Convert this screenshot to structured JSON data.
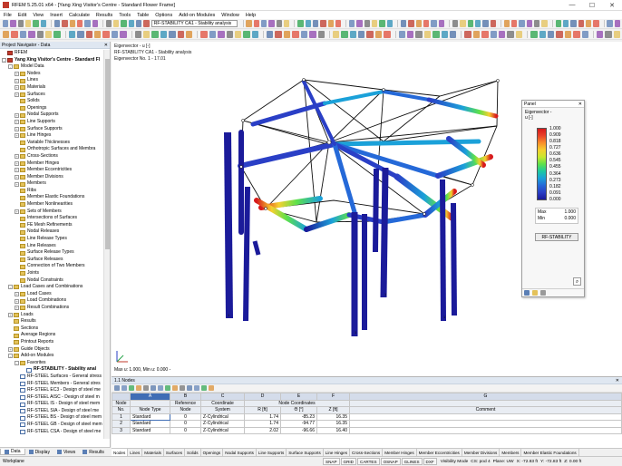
{
  "window": {
    "title": "RFEM 5.25.01 x64 - [Yang Xing Visitor's Centre - Standard Flower Frame]",
    "minimize": "—",
    "maximize": "☐",
    "close": "✕"
  },
  "menu": [
    "File",
    "Edit",
    "View",
    "Insert",
    "Calculate",
    "Results",
    "Tools",
    "Table",
    "Options",
    "Add-on Modules",
    "Window",
    "Help"
  ],
  "toolbar": {
    "case_combo": "RF-STABILITY CA1 - Stability analysis"
  },
  "navigator": {
    "title": "Project Navigator - Data",
    "tree": [
      {
        "label": "RFEM",
        "level": 0,
        "type": "root",
        "exp": ""
      },
      {
        "label": "Yang Xing Visitor's Centre - Standard Fl",
        "level": 0,
        "type": "root",
        "exp": "-",
        "bold": true
      },
      {
        "label": "Model Data",
        "level": 1,
        "type": "folder",
        "exp": "-"
      },
      {
        "label": "Nodes",
        "level": 2,
        "type": "folder",
        "exp": "+"
      },
      {
        "label": "Lines",
        "level": 2,
        "type": "folder",
        "exp": "+"
      },
      {
        "label": "Materials",
        "level": 2,
        "type": "folder",
        "exp": "+"
      },
      {
        "label": "Surfaces",
        "level": 2,
        "type": "folder",
        "exp": "+"
      },
      {
        "label": "Solids",
        "level": 2,
        "type": "folder",
        "exp": ""
      },
      {
        "label": "Openings",
        "level": 2,
        "type": "folder",
        "exp": ""
      },
      {
        "label": "Nodal Supports",
        "level": 2,
        "type": "folder",
        "exp": "+"
      },
      {
        "label": "Line Supports",
        "level": 2,
        "type": "folder",
        "exp": "+"
      },
      {
        "label": "Surface Supports",
        "level": 2,
        "type": "folder",
        "exp": "+"
      },
      {
        "label": "Line Hinges",
        "level": 2,
        "type": "folder",
        "exp": "+"
      },
      {
        "label": "Variable Thicknesses",
        "level": 2,
        "type": "folder",
        "exp": ""
      },
      {
        "label": "Orthotropic Surfaces and Membra",
        "level": 2,
        "type": "folder",
        "exp": ""
      },
      {
        "label": "Cross-Sections",
        "level": 2,
        "type": "folder",
        "exp": "+"
      },
      {
        "label": "Member Hinges",
        "level": 2,
        "type": "folder",
        "exp": "+"
      },
      {
        "label": "Member Eccentricities",
        "level": 2,
        "type": "folder",
        "exp": "+"
      },
      {
        "label": "Member Divisions",
        "level": 2,
        "type": "folder",
        "exp": "+"
      },
      {
        "label": "Members",
        "level": 2,
        "type": "folder",
        "exp": "+"
      },
      {
        "label": "Ribs",
        "level": 2,
        "type": "folder",
        "exp": ""
      },
      {
        "label": "Member Elastic Foundations",
        "level": 2,
        "type": "folder",
        "exp": ""
      },
      {
        "label": "Member Nonlinearities",
        "level": 2,
        "type": "folder",
        "exp": ""
      },
      {
        "label": "Sets of Members",
        "level": 2,
        "type": "folder",
        "exp": "+"
      },
      {
        "label": "Intersections of Surfaces",
        "level": 2,
        "type": "folder",
        "exp": ""
      },
      {
        "label": "FE Mesh Refinements",
        "level": 2,
        "type": "folder",
        "exp": ""
      },
      {
        "label": "Nodal Releases",
        "level": 2,
        "type": "folder",
        "exp": ""
      },
      {
        "label": "Line Release Types",
        "level": 2,
        "type": "folder",
        "exp": ""
      },
      {
        "label": "Line Releases",
        "level": 2,
        "type": "folder",
        "exp": ""
      },
      {
        "label": "Surface Release Types",
        "level": 2,
        "type": "folder",
        "exp": ""
      },
      {
        "label": "Surface Releases",
        "level": 2,
        "type": "folder",
        "exp": ""
      },
      {
        "label": "Connection of Two Members",
        "level": 2,
        "type": "folder",
        "exp": ""
      },
      {
        "label": "Joints",
        "level": 2,
        "type": "folder",
        "exp": ""
      },
      {
        "label": "Nodal Constraints",
        "level": 2,
        "type": "folder",
        "exp": ""
      },
      {
        "label": "Load Cases and Combinations",
        "level": 1,
        "type": "folder",
        "exp": "-"
      },
      {
        "label": "Load Cases",
        "level": 2,
        "type": "folder",
        "exp": "+"
      },
      {
        "label": "Load Combinations",
        "level": 2,
        "type": "folder",
        "exp": "+"
      },
      {
        "label": "Result Combinations",
        "level": 2,
        "type": "folder",
        "exp": "+"
      },
      {
        "label": "Loads",
        "level": 1,
        "type": "folder",
        "exp": "+"
      },
      {
        "label": "Results",
        "level": 1,
        "type": "folder",
        "exp": ""
      },
      {
        "label": "Sections",
        "level": 1,
        "type": "folder",
        "exp": ""
      },
      {
        "label": "Average Regions",
        "level": 1,
        "type": "folder",
        "exp": ""
      },
      {
        "label": "Printout Reports",
        "level": 1,
        "type": "folder",
        "exp": ""
      },
      {
        "label": "Guide Objects",
        "level": 1,
        "type": "folder",
        "exp": "+"
      },
      {
        "label": "Add-on Modules",
        "level": 1,
        "type": "folder",
        "exp": "-"
      },
      {
        "label": "Favorites",
        "level": 2,
        "type": "folder",
        "exp": "-"
      },
      {
        "label": "RF-STABILITY - Stability anal",
        "level": 3,
        "type": "doc",
        "exp": "",
        "bold": true
      },
      {
        "label": "RF-STEEL Surfaces - General stress",
        "level": 2,
        "type": "doc",
        "exp": ""
      },
      {
        "label": "RF-STEEL Members - General stres",
        "level": 2,
        "type": "doc",
        "exp": ""
      },
      {
        "label": "RF-STEEL EC3 - Design of steel me",
        "level": 2,
        "type": "doc",
        "exp": ""
      },
      {
        "label": "RF-STEEL AISC - Design of steel m",
        "level": 2,
        "type": "doc",
        "exp": ""
      },
      {
        "label": "RF-STEEL IS - Design of steel mem",
        "level": 2,
        "type": "doc",
        "exp": ""
      },
      {
        "label": "RF-STEEL SIA - Design of steel me",
        "level": 2,
        "type": "doc",
        "exp": ""
      },
      {
        "label": "RF-STEEL BS - Design of steel mem",
        "level": 2,
        "type": "doc",
        "exp": ""
      },
      {
        "label": "RF-STEEL GB - Design of steel mem",
        "level": 2,
        "type": "doc",
        "exp": ""
      },
      {
        "label": "RF-STEEL CSA - Design of steel me",
        "level": 2,
        "type": "doc",
        "exp": ""
      }
    ],
    "tabs": [
      "Data",
      "Display",
      "Views",
      "Results"
    ]
  },
  "viewport": {
    "line1": "Eigenvector - u [-]",
    "line2": "RF-STABILITY CA1 - Stability analysis",
    "line3": "Eigenvector No. 1 - 17.01",
    "bottom": "Max u: 1.000, Min u: 0.000 -"
  },
  "panel": {
    "title": "Panel",
    "close": "✕",
    "heading": "Eigenvector -",
    "unit": "u [-]",
    "legend_values": [
      "1.000",
      "0.909",
      "0.818",
      "0.727",
      "0.636",
      "0.545",
      "0.455",
      "0.364",
      "0.273",
      "0.182",
      "0.091",
      "0.000"
    ],
    "max_label": "Max",
    "max_value": "1.000",
    "min_label": "Min",
    "min_value": "0.000",
    "button": "RF-STABILITY",
    "colors": [
      "#d7191c",
      "#f98e2a",
      "#f6d02f",
      "#5ee14a",
      "#1ba1d9",
      "#1b1b9a"
    ]
  },
  "table": {
    "title": "1.1 Nodes",
    "letters": [
      "A",
      "B",
      "C",
      "D",
      "E",
      "F",
      "G"
    ],
    "header1": [
      "Node",
      "",
      "Reference",
      "Coordinate",
      "",
      "Node Coordinates",
      "",
      ""
    ],
    "header2": [
      "No.",
      "Node Type",
      "Node",
      "System",
      "R [ft]",
      "Θ [°]",
      "Z [ft]",
      "Comment"
    ],
    "rows": [
      [
        "1",
        "Standard",
        "0",
        "Z-Cylindrical",
        "1.74",
        "-85.23",
        "16.35",
        ""
      ],
      [
        "2",
        "Standard",
        "0",
        "Z-Cylindrical",
        "1.74",
        "-94.77",
        "16.35",
        ""
      ],
      [
        "3",
        "Standard",
        "0",
        "Z-Cylindrical",
        "2.02",
        "-96.66",
        "16.40",
        ""
      ]
    ],
    "tabs": [
      "Nodes",
      "Lines",
      "Materials",
      "Surfaces",
      "Solids",
      "Openings",
      "Nodal Supports",
      "Line Supports",
      "Surface Supports",
      "Line Hinges",
      "Cross-Sections",
      "Member Hinges",
      "Member Eccentricities",
      "Member Divisions",
      "Members",
      "Member Elastic Foundations"
    ]
  },
  "status": {
    "left": "Workplane",
    "buttons": [
      "SNAP",
      "GRID",
      "CARTES",
      "OSNAP",
      "GLINES",
      "DXF"
    ],
    "mode": "Visibility Mode",
    "cs": "CS: pod 4",
    "plane": "Plane: UW",
    "x": "X: -72.83 ft",
    "y": "Y: -72.83 ft",
    "z": "Z: 0.00 ft"
  }
}
